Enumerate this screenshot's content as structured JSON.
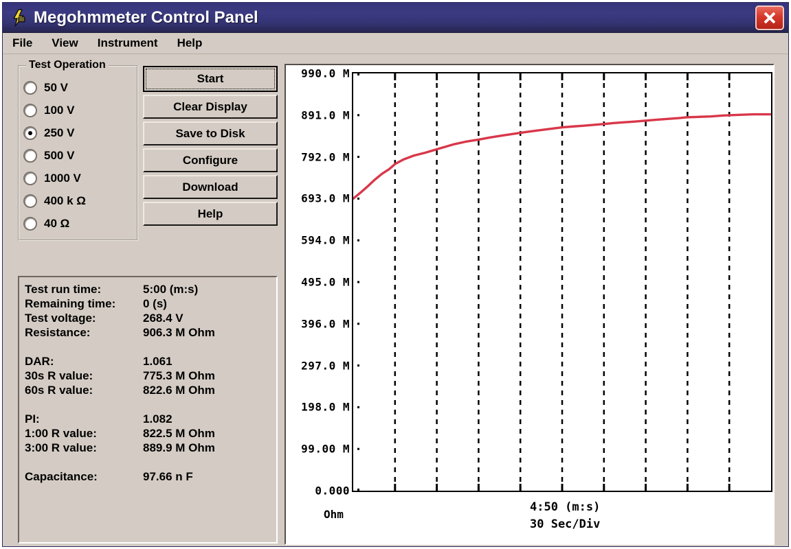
{
  "window": {
    "title": "Megohmmeter Control Panel",
    "icon": "app-icon",
    "close_label": "×"
  },
  "menu": {
    "items": [
      {
        "label": "File"
      },
      {
        "label": "View"
      },
      {
        "label": "Instrument"
      },
      {
        "label": "Help"
      }
    ]
  },
  "test_operation": {
    "title": "Test Operation",
    "options": [
      {
        "label": "50 V",
        "selected": false
      },
      {
        "label": "100 V",
        "selected": false
      },
      {
        "label": "250 V",
        "selected": true
      },
      {
        "label": "500 V",
        "selected": false
      },
      {
        "label": "1000 V",
        "selected": false
      },
      {
        "label": "400 k Ω",
        "selected": false
      },
      {
        "label": "40  Ω",
        "selected": false
      }
    ]
  },
  "buttons": [
    {
      "label": "Start",
      "default": true
    },
    {
      "label": "Clear Display",
      "default": false
    },
    {
      "label": "Save to Disk",
      "default": false
    },
    {
      "label": "Configure",
      "default": false
    },
    {
      "label": "Download",
      "default": false
    },
    {
      "label": "Help",
      "default": false
    }
  ],
  "readings": [
    {
      "label": "Test run time:",
      "value": "5:00 (m:s)"
    },
    {
      "label": "Remaining time:",
      "value": "0 (s)"
    },
    {
      "label": "Test voltage:",
      "value": "268.4  V"
    },
    {
      "label": "Resistance:",
      "value": "906.3 M Ohm"
    },
    {
      "label": "",
      "value": ""
    },
    {
      "label": "DAR:",
      "value": "1.061"
    },
    {
      "label": "30s R value:",
      "value": "775.3 M Ohm"
    },
    {
      "label": "60s R value:",
      "value": "822.6 M Ohm"
    },
    {
      "label": "",
      "value": ""
    },
    {
      "label": "PI:",
      "value": "1.082"
    },
    {
      "label": "1:00 R value:",
      "value": "822.5 M Ohm"
    },
    {
      "label": "3:00 R value:",
      "value": "889.9 M Ohm"
    },
    {
      "label": "",
      "value": ""
    },
    {
      "label": "Capacitance:",
      "value": "97.66 n F"
    }
  ],
  "chart_data": {
    "type": "line",
    "title": "",
    "xlabel": "30 Sec/Div",
    "ylabel": "Ohm",
    "unit_label": "Ohm",
    "duration_label": "4:50  (m:s)",
    "div_label": "30 Sec/Div",
    "ylim": [
      0,
      990000000
    ],
    "xlim": [
      0,
      290
    ],
    "grid": true,
    "gridlines_x": 9,
    "yticks": [
      0,
      99000000,
      198000000,
      297000000,
      396000000,
      495000000,
      594000000,
      693000000,
      792000000,
      891000000,
      990000000
    ],
    "ytick_labels": [
      "0.000",
      "99.00 M",
      "198.0 M",
      "297.0 M",
      "396.0 M",
      "495.0 M",
      "594.0 M",
      "693.0 M",
      "792.0 M",
      "891.0 M",
      "990.0 M"
    ],
    "series": [
      {
        "name": "Resistance",
        "color": "#d9374a",
        "x": [
          0,
          5,
          10,
          15,
          20,
          25,
          29,
          35,
          42,
          50,
          58,
          64,
          70,
          78,
          87,
          95,
          102,
          110,
          116,
          124,
          131,
          138,
          145,
          152,
          160,
          167,
          174,
          180,
          188,
          196,
          203,
          210,
          218,
          226,
          232,
          240,
          248,
          256,
          262,
          270,
          278,
          285,
          290
        ],
        "y": [
          693,
          707,
          722,
          738,
          752,
          763,
          775,
          786,
          795,
          802,
          810,
          816,
          822,
          828,
          833,
          838,
          842,
          846,
          849,
          853,
          856,
          859,
          862,
          864,
          866,
          868,
          870,
          872,
          874,
          876,
          878,
          880,
          882,
          884,
          886,
          887,
          888,
          890,
          891,
          892,
          893,
          893,
          893
        ],
        "y_unit": "M Ohm"
      }
    ]
  }
}
